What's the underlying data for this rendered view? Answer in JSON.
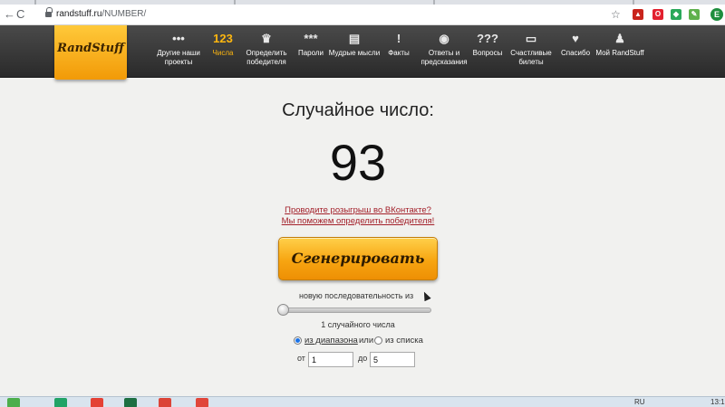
{
  "browser": {
    "url_host": "randstuff.ru",
    "url_path": "/NUMBER/",
    "back_glyph": "←",
    "reload_glyph": "C",
    "star_glyph": "☆",
    "profile_initial": "E",
    "extensions": [
      {
        "name": "pdf-extension-icon",
        "glyph": "▲",
        "color": "#c9241c"
      },
      {
        "name": "opera-extension-icon",
        "glyph": "O",
        "color": "#e2202f"
      },
      {
        "name": "green-extension-icon",
        "glyph": "◆",
        "color": "#2aa85a"
      },
      {
        "name": "leaf-extension-icon",
        "glyph": "✎",
        "color": "#5fb14d"
      }
    ]
  },
  "site": {
    "logo": "RandStuff",
    "nav": [
      {
        "icon": "•••",
        "label": "Другие наши проекты"
      },
      {
        "icon": "123",
        "label": "Числа",
        "active": true
      },
      {
        "icon": "♛",
        "label": "Определить победителя"
      },
      {
        "icon": "***",
        "label": "Пароли"
      },
      {
        "icon": "▤",
        "label": "Мудрые мысли"
      },
      {
        "icon": "!",
        "label": "Факты"
      },
      {
        "icon": "◉",
        "label": "Ответы и предсказания"
      },
      {
        "icon": "???",
        "label": "Вопросы"
      },
      {
        "icon": "▭",
        "label": "Счастливые билеты"
      },
      {
        "icon": "♥",
        "label": "Спасибо"
      },
      {
        "icon": "♟",
        "label": "Мой RandStuff"
      }
    ]
  },
  "main": {
    "title": "Случайное число:",
    "result": "93",
    "promo_line1": "Проводите розыгрыш во ВКонтакте?",
    "promo_line2": "Мы поможем определить победителя!",
    "generate_label": "Сгенерировать",
    "sequence_label": "новую последовательность из",
    "count_label": "1 случайного числа",
    "mode_range_label": "из диапазона",
    "mode_or": "или",
    "mode_list_label": "из списка",
    "from_label": "от",
    "to_label": "до",
    "from_value": "1",
    "to_value": "5"
  },
  "taskbar": {
    "lang": "RU",
    "clock": "13:1"
  }
}
